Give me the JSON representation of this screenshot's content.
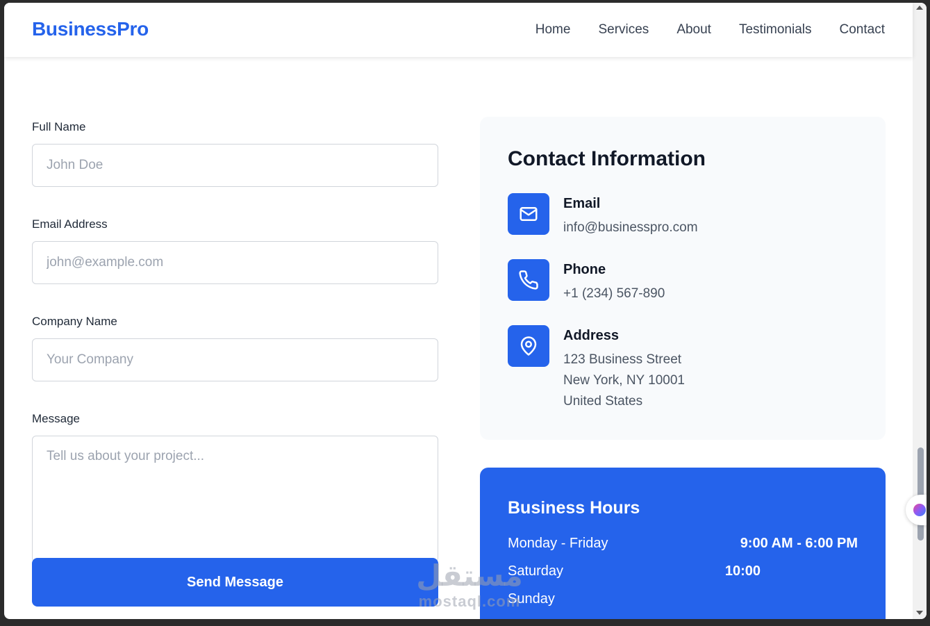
{
  "nav": {
    "brand": "BusinessPro",
    "links": [
      "Home",
      "Services",
      "About",
      "Testimonials",
      "Contact"
    ]
  },
  "form": {
    "full_name": {
      "label": "Full Name",
      "placeholder": "John Doe"
    },
    "email": {
      "label": "Email Address",
      "placeholder": "john@example.com"
    },
    "company": {
      "label": "Company Name",
      "placeholder": "Your Company"
    },
    "message": {
      "label": "Message",
      "placeholder": "Tell us about your project..."
    },
    "submit_label": "Send Message"
  },
  "contact_info": {
    "title": "Contact Information",
    "email": {
      "heading": "Email",
      "value": "info@businesspro.com",
      "icon": "mail-icon"
    },
    "phone": {
      "heading": "Phone",
      "value": "+1 (234) 567-890",
      "icon": "phone-icon"
    },
    "address": {
      "heading": "Address",
      "lines": [
        "123 Business Street",
        "New York, NY 10001",
        "United States"
      ],
      "icon": "map-pin-icon"
    }
  },
  "business_hours": {
    "title": "Business Hours",
    "rows": [
      {
        "day": "Monday - Friday",
        "time": "9:00 AM - 6:00 PM"
      },
      {
        "day": "Saturday",
        "time": "10:00"
      },
      {
        "day": "Sunday",
        "time": ""
      }
    ]
  },
  "watermark": {
    "arabic": "مستقل",
    "latin": "mostaql.com"
  },
  "colors": {
    "primary": "#2563eb",
    "card_bg": "#f8fafc",
    "text": "#111827",
    "muted": "#4b5563"
  }
}
